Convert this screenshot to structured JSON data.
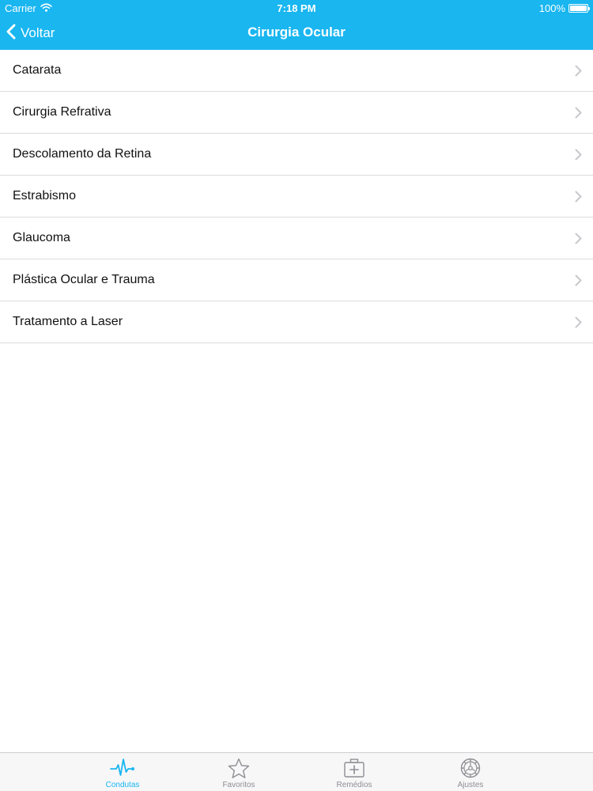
{
  "status_bar": {
    "carrier": "Carrier",
    "time": "7:18 PM",
    "battery": "100%",
    "icons": [
      "wifi-icon",
      "battery-icon"
    ]
  },
  "nav_bar": {
    "back_label": "Voltar",
    "title": "Cirurgia Ocular",
    "back_icon": "chevron-left-icon"
  },
  "list": {
    "items": [
      {
        "label": "Catarata"
      },
      {
        "label": "Cirurgia Refrativa"
      },
      {
        "label": "Descolamento da Retina"
      },
      {
        "label": "Estrabismo"
      },
      {
        "label": "Glaucoma"
      },
      {
        "label": "Plástica Ocular e Trauma"
      },
      {
        "label": "Tratamento a Laser"
      }
    ],
    "disclosure_icon": "chevron-right-icon"
  },
  "tab_bar": {
    "tabs": [
      {
        "label": "Condutas",
        "icon": "heartbeat-icon",
        "active": true
      },
      {
        "label": "Favoritos",
        "icon": "star-icon",
        "active": false
      },
      {
        "label": "Remédios",
        "icon": "medical-kit-icon",
        "active": false
      },
      {
        "label": "Ajustes",
        "icon": "gear-icon",
        "active": false
      }
    ]
  },
  "colors": {
    "accent": "#19b6f0",
    "header_background": "#19b6f0",
    "separator": "#dcdce0",
    "inactive_tab": "#8e8e93"
  }
}
